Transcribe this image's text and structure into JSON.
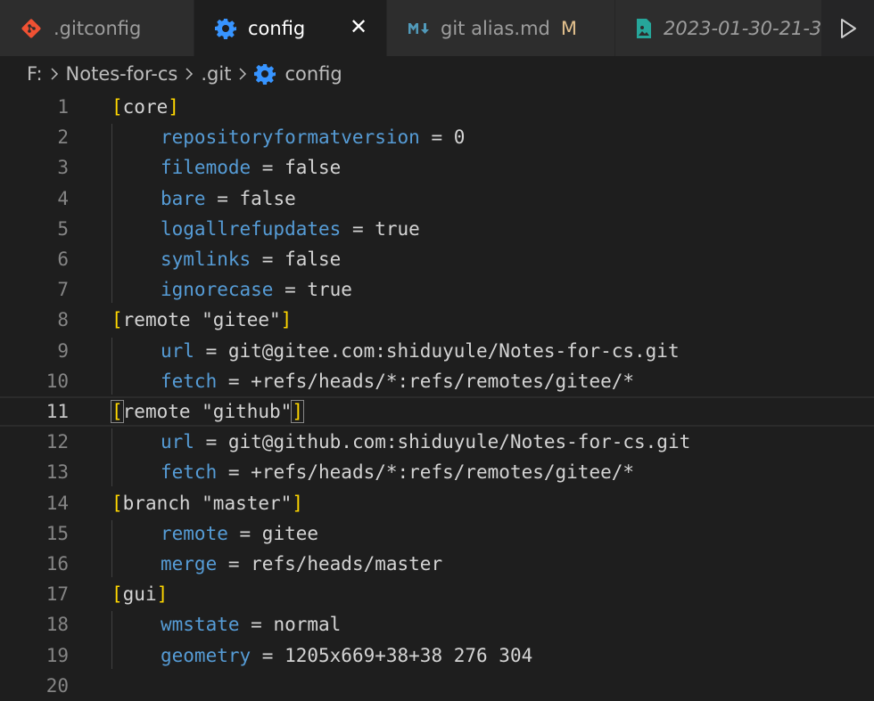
{
  "tabs": [
    {
      "label": ".gitconfig",
      "icon": "git-icon",
      "active": false
    },
    {
      "label": "config",
      "icon": "gear-icon",
      "active": true,
      "close": "✕"
    },
    {
      "label": "git alias.md",
      "icon": "markdown-icon",
      "badge": "M",
      "active": false
    },
    {
      "label": "2023-01-30-21-3",
      "icon": "image-file-icon",
      "active": false
    }
  ],
  "breadcrumb": [
    "F:",
    "Notes-for-cs",
    ".git",
    "config"
  ],
  "editor": {
    "current_line": 11,
    "lines": [
      {
        "n": "1",
        "type": "section",
        "text": "core"
      },
      {
        "n": "2",
        "type": "kv",
        "key": "repositoryformatversion",
        "value": "0"
      },
      {
        "n": "3",
        "type": "kv",
        "key": "filemode",
        "value": "false"
      },
      {
        "n": "4",
        "type": "kv",
        "key": "bare",
        "value": "false"
      },
      {
        "n": "5",
        "type": "kv",
        "key": "logallrefupdates",
        "value": "true"
      },
      {
        "n": "6",
        "type": "kv",
        "key": "symlinks",
        "value": "false"
      },
      {
        "n": "7",
        "type": "kv",
        "key": "ignorecase",
        "value": "true"
      },
      {
        "n": "8",
        "type": "section",
        "text": "remote \"gitee\""
      },
      {
        "n": "9",
        "type": "kv",
        "key": "url",
        "value": "git@gitee.com:shiduyule/Notes-for-cs.git"
      },
      {
        "n": "10",
        "type": "kv",
        "key": "fetch",
        "value": "+refs/heads/*:refs/remotes/gitee/*"
      },
      {
        "n": "11",
        "type": "section",
        "text": "remote \"github\""
      },
      {
        "n": "12",
        "type": "kv",
        "key": "url",
        "value": "git@github.com:shiduyule/Notes-for-cs.git"
      },
      {
        "n": "13",
        "type": "kv",
        "key": "fetch",
        "value": "+refs/heads/*:refs/remotes/gitee/*"
      },
      {
        "n": "14",
        "type": "section",
        "text": "branch \"master\""
      },
      {
        "n": "15",
        "type": "kv",
        "key": "remote",
        "value": "gitee"
      },
      {
        "n": "16",
        "type": "kv",
        "key": "merge",
        "value": "refs/heads/master"
      },
      {
        "n": "17",
        "type": "section",
        "text": "gui"
      },
      {
        "n": "18",
        "type": "kv",
        "key": "wmstate",
        "value": "normal"
      },
      {
        "n": "19",
        "type": "kv",
        "key": "geometry",
        "value": "1205x669+38+38 276 304"
      },
      {
        "n": "20",
        "type": "empty"
      }
    ]
  },
  "colors": {
    "key": "#569cd6",
    "bracket": "#ffd700",
    "text": "#d4d4d4",
    "git_icon": "#f05133",
    "gear_icon": "#3794ff",
    "md_icon": "#519aba",
    "image_icon": "#26a69a"
  }
}
